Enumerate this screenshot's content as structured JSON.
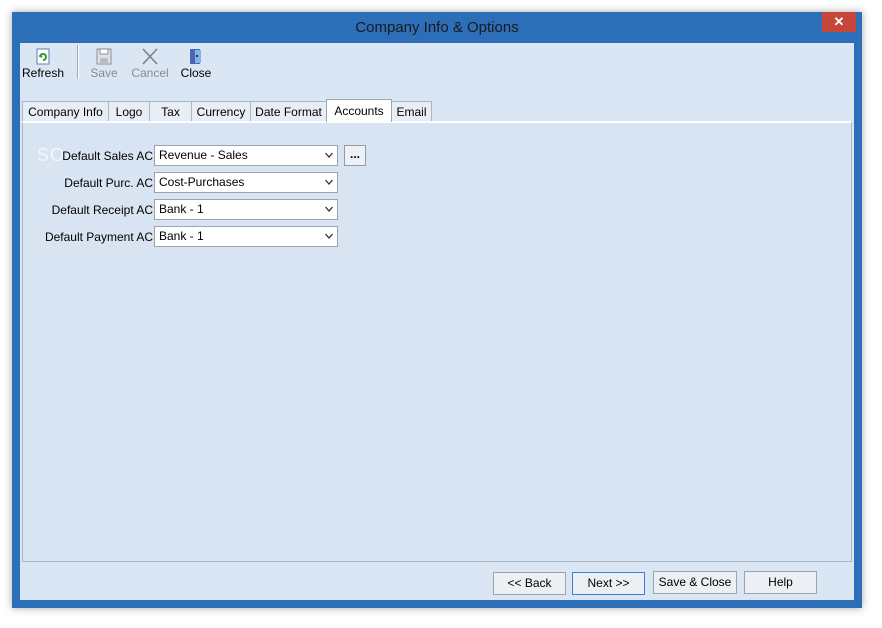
{
  "window": {
    "title": "Company Info & Options",
    "close_glyph": "✕"
  },
  "toolbar": {
    "refresh_label": "Refresh",
    "save_label": "Save",
    "cancel_label": "Cancel",
    "close_label": "Close"
  },
  "tabs": [
    {
      "label": "Company Info",
      "active": false
    },
    {
      "label": "Logo",
      "active": false
    },
    {
      "label": "Tax",
      "active": false
    },
    {
      "label": "Currency",
      "active": false
    },
    {
      "label": "Date Format",
      "active": false
    },
    {
      "label": "Accounts",
      "active": true
    },
    {
      "label": "Email",
      "active": false
    }
  ],
  "accounts": {
    "watermark": "SO",
    "fields": [
      {
        "label": "Default Sales AC",
        "value": "Revenue - Sales"
      },
      {
        "label": "Default Purc. AC",
        "value": "Cost-Purchases"
      },
      {
        "label": "Default Receipt AC",
        "value": "Bank - 1"
      },
      {
        "label": "Default Payment AC",
        "value": "Bank - 1"
      }
    ],
    "browse_label": "..."
  },
  "footer": {
    "back_label": "<< Back",
    "next_label": "Next >>",
    "save_close_label": "Save & Close",
    "help_label": "Help"
  },
  "colors": {
    "window_frame": "#2d6eb8",
    "client_bg": "#dae6f3",
    "close_button": "#c7463a"
  }
}
